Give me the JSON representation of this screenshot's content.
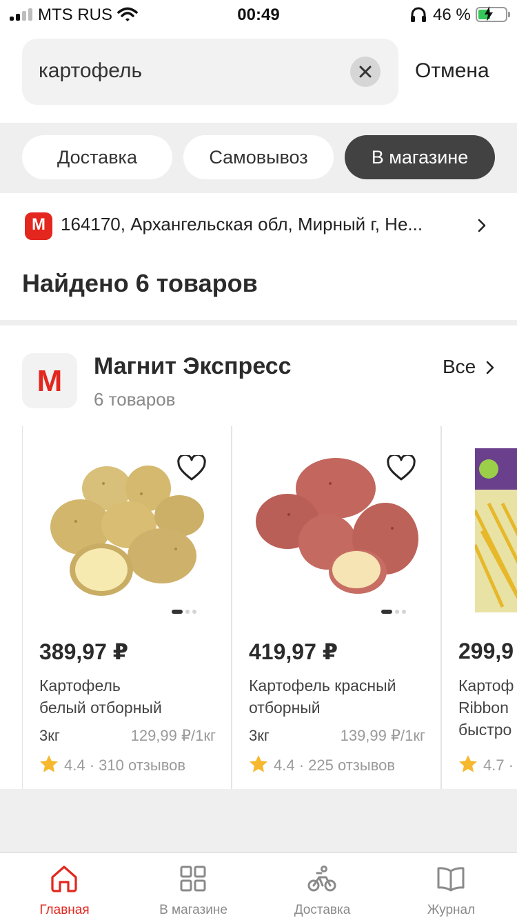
{
  "status_bar": {
    "carrier": "MTS RUS",
    "time": "00:49",
    "battery": "46 %",
    "battery_level": 0.46
  },
  "search": {
    "query": "картофель",
    "cancel_label": "Отмена"
  },
  "modes": [
    {
      "label": "Доставка",
      "active": false
    },
    {
      "label": "Самовывоз",
      "active": false
    },
    {
      "label": "В магазине",
      "active": true
    }
  ],
  "location": {
    "logo_letter": "М",
    "address": "164170, Архангельская обл, Мирный г, Не..."
  },
  "found_title": "Найдено 6 товаров",
  "store": {
    "logo_letter": "М",
    "name": "Магнит Экспресс",
    "count": "6 товаров",
    "all_label": "Все"
  },
  "products": [
    {
      "price": "389,97 ₽",
      "name_line1": "Картофель",
      "name_line2": "белый отборный",
      "weight": "3кг",
      "unit_price": "129,99 ₽/1кг",
      "rating": "4.4",
      "reviews": "310 отзывов",
      "image": "white-potatoes"
    },
    {
      "price": "419,97 ₽",
      "name_line1": "Картофель красный",
      "name_line2": "отборный",
      "weight": "3кг",
      "unit_price": "139,99 ₽/1кг",
      "rating": "4.4",
      "reviews": "225 отзывов",
      "image": "red-potatoes"
    },
    {
      "price": "299,9",
      "name_line1": "Картоф",
      "name_line2": "Ribbon",
      "name_line3": "быстро",
      "rating": "4.7",
      "image": "fries-bag"
    }
  ],
  "tabbar": [
    {
      "label": "Главная",
      "icon": "home-icon",
      "active": true
    },
    {
      "label": "В магазине",
      "icon": "grid-icon",
      "active": false
    },
    {
      "label": "Доставка",
      "icon": "bike-icon",
      "active": false
    },
    {
      "label": "Журнал",
      "icon": "book-icon",
      "active": false
    }
  ],
  "colors": {
    "brand_red": "#e3261e",
    "active_pill": "#424242",
    "star": "#f5b82e"
  }
}
